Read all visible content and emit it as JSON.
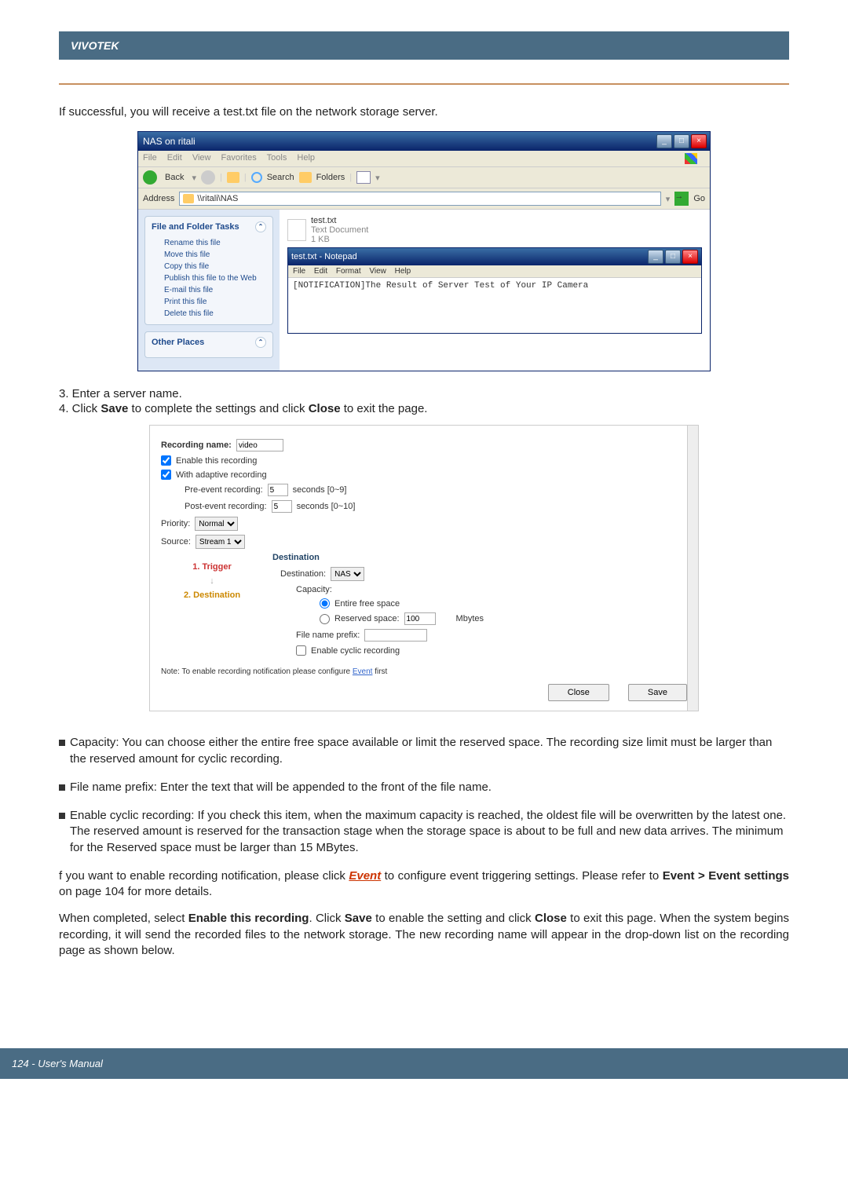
{
  "header": {
    "brand": "VIVOTEK"
  },
  "intro": "If successful, you will receive a test.txt file on the network storage server.",
  "screenshot1": {
    "title": "NAS on ritali",
    "menubar": [
      "File",
      "Edit",
      "View",
      "Favorites",
      "Tools",
      "Help"
    ],
    "toolbar": {
      "back": "Back",
      "search": "Search",
      "folders": "Folders"
    },
    "addressLabel": "Address",
    "address": "\\\\ritali\\NAS",
    "go": "Go",
    "sidePanelTitle1": "File and Folder Tasks",
    "tasks": [
      "Rename this file",
      "Move this file",
      "Copy this file",
      "Publish this file to the Web",
      "E-mail this file",
      "Print this file",
      "Delete this file"
    ],
    "sidePanelTitle2": "Other Places",
    "file": {
      "name": "test.txt",
      "type": "Text Document",
      "size": "1 KB"
    },
    "notepad": {
      "title": "test.txt - Notepad",
      "menu": [
        "File",
        "Edit",
        "Format",
        "View",
        "Help"
      ],
      "body": "[NOTIFICATION]The Result of Server Test of Your IP Camera"
    }
  },
  "steps": {
    "s3": "3. Enter a server name.",
    "s4a": "4. Click ",
    "s4b": "Save",
    "s4c": " to complete the settings and click ",
    "s4d": "Close",
    "s4e": " to exit the page."
  },
  "screenshot2": {
    "recNameLabel": "Recording name:",
    "recName": "video",
    "enableRec": "Enable this recording",
    "adaptive": "With adaptive recording",
    "preLabel": "Pre-event recording:",
    "preVal": "5",
    "preUnit": "seconds [0~9]",
    "postLabel": "Post-event recording:",
    "postVal": "5",
    "postUnit": "seconds [0~10]",
    "priorityLabel": "Priority:",
    "priorityVal": "Normal",
    "sourceLabel": "Source:",
    "sourceVal": "Stream 1",
    "trigger": "1. Trigger",
    "destStep": "2. Destination",
    "destinationHeader": "Destination",
    "destinationLabel": "Destination:",
    "destinationVal": "NAS",
    "capacityLabel": "Capacity:",
    "entire": "Entire free space",
    "reservedLabel": "Reserved space:",
    "reservedVal": "100",
    "reservedUnit": "Mbytes",
    "prefixLabel": "File name prefix:",
    "cyclic": "Enable cyclic recording",
    "noteA": "Note: To enable recording notification please configure ",
    "noteLink": "Event",
    "noteB": " first",
    "close": "Close",
    "save": "Save"
  },
  "bullets": {
    "b1": "Capacity: You can choose either the entire free space available or limit the reserved space. The recording size limit must be larger than the reserved amount for cyclic recording.",
    "b2": "File name prefix: Enter the text that will be appended to the front of the file name.",
    "b3": "Enable cyclic recording: If you check this item, when the maximum capacity is reached, the oldest file will be overwritten by the latest one. The reserved amount is reserved for the transaction stage when the storage space is about to be full and new data arrives. The minimum for the Reserved space must be larger than 15 MBytes."
  },
  "notifPara": {
    "a": "f you want to enable recording notification, please click ",
    "link": "Event",
    "b": " to configure event triggering settings. Please refer to ",
    "bold": "Event > Event settings",
    "c": " on page 104 for more details."
  },
  "completedPara": {
    "a": "When completed, select ",
    "b1": "Enable this recording",
    "c": ". Click ",
    "b2": "Save",
    "d": " to enable the setting and click ",
    "b3": "Close",
    "e": " to exit this page. When the system begins recording, it will send the recorded files to the network storage. The new recording name will appear in the drop-down list on the recording page as shown below."
  },
  "footer": "124 - User's Manual"
}
